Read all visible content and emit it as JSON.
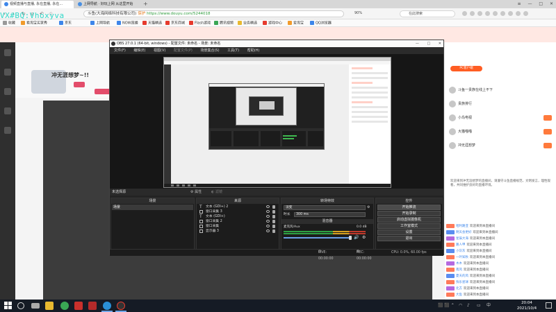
{
  "browser": {
    "tabs": [
      {
        "label": "视频直播与直播, 永在直播, 永在..."
      },
      {
        "label": "上网导航 · 好玩上网 从这里开始"
      }
    ],
    "addr_site": "斗鱼(大海网络科技有限公司)",
    "addr_protect": "保护",
    "url": "https://www.douyu.com/5244018",
    "zoom": "90%",
    "search_placeholder": "在此搜索"
  },
  "bookmarks": [
    {
      "label": "收藏",
      "color": "gr"
    },
    {
      "label": "看淘宝买家秀",
      "color": "o"
    },
    {
      "label": "京东",
      "color": "b"
    },
    {
      "label": "上网导航",
      "color": "b"
    },
    {
      "label": "NOW直播",
      "color": "b"
    },
    {
      "label": "天猫精选",
      "color": "r"
    },
    {
      "label": "京东商城",
      "color": "r"
    },
    {
      "label": "Flash游戏",
      "color": "r"
    },
    {
      "label": "腾讯视频",
      "color": "g"
    },
    {
      "label": "业务精选",
      "color": "y"
    },
    {
      "label": "游戏中心",
      "color": "r"
    },
    {
      "label": "爱淘宝",
      "color": "o"
    },
    {
      "label": "QQ浏览器",
      "color": "b"
    }
  ],
  "watermark": "VX#BQ:Vhoxyva",
  "douyu": {
    "streamer_name": "冲无涯想梦~!!",
    "pc_btn": "PC客户端",
    "right_rows": [
      {
        "label": "斗鱼一贵族在线上不下"
      },
      {
        "label": "贵族排行"
      },
      {
        "label": "小鸟电视"
      },
      {
        "label": "大猫喵喵"
      },
      {
        "label": "冲无涯想梦"
      }
    ],
    "chat": [
      {
        "nick": "哈利路亚",
        "text": "欢迎来到本直播间",
        "lv": ""
      },
      {
        "nick": "明天会更好",
        "text": "欢迎来到本直播间",
        "lv": "b"
      },
      {
        "nick": "星辰大海",
        "text": "欢迎来到本直播间",
        "lv": "p"
      },
      {
        "nick": "路人甲",
        "text": "欢迎来到本直播间",
        "lv": ""
      },
      {
        "nick": "小灰灰",
        "text": "欢迎来到本直播间",
        "lv": "b"
      },
      {
        "nick": "一叶知秋",
        "text": "欢迎来到本直播间",
        "lv": ""
      },
      {
        "nick": "木木",
        "text": "欢迎来到本直播间",
        "lv": "p"
      },
      {
        "nick": "南风",
        "text": "欢迎来到本直播间",
        "lv": ""
      },
      {
        "nick": "夏天的风",
        "text": "欢迎来到本直播间",
        "lv": "b"
      },
      {
        "nick": "快乐星球",
        "text": "欢迎来到本直播间",
        "lv": ""
      },
      {
        "nick": "北方",
        "text": "欢迎来到本直播间",
        "lv": "p"
      },
      {
        "nick": "大鱼",
        "text": "欢迎来到本直播间",
        "lv": ""
      },
      {
        "nick": "老王",
        "text": "欢迎来到本直播间",
        "lv": "b"
      },
      {
        "nick": "清风",
        "text": "欢迎来到本直播间",
        "lv": ""
      }
    ],
    "blurb": "欢迎来到冲无涯想梦的直播间，请遵守斗鱼直播规范，文明发言，理性观看，共同维护良好的直播环境。"
  },
  "obs": {
    "title": "OBS 27.0.1 (64-bit, windows) - 配置文件: 未命名 - 场景: 未命名",
    "menu": [
      "文件(F)",
      "编辑(E)",
      "视图(V)",
      "配置文件(P)",
      "场景集合(S)",
      "工具(T)",
      "帮助(H)"
    ],
    "no_source": "未选择源",
    "properties": "属性",
    "filters": "滤镜",
    "docks": {
      "scenes": "场景",
      "sources": "来源",
      "transitions": "转场特效",
      "mixer": "混音器",
      "controls": "控件"
    },
    "scene_item": "场景",
    "sources": [
      {
        "label": "文本 (GDI+) 2",
        "icon": "text"
      },
      {
        "label": "窗口采集 3",
        "icon": "window"
      },
      {
        "label": "文本 (GDI+)",
        "icon": "text"
      },
      {
        "label": "窗口采集 2",
        "icon": "window"
      },
      {
        "label": "窗口采集",
        "icon": "window"
      },
      {
        "label": "显示器 3",
        "icon": "display"
      }
    ],
    "transition": {
      "name": "淡变",
      "duration_label": "时长",
      "duration_value": "300 ms"
    },
    "mixer": {
      "channel": "麦克风/Aux",
      "db": "0.0 dB"
    },
    "controls": [
      "开始推流",
      "开始录制",
      "启动虚拟摄像机",
      "工作室模式",
      "设置",
      "退出"
    ],
    "status": {
      "live": "LIVE: 00:00:00",
      "rec": "REC: 00:00:00",
      "cpu": "CPU: 0.0%, 60.00 fps"
    }
  },
  "taskbar": {
    "time": "20:04",
    "date": "2021/10/4",
    "tray_lang": "中"
  }
}
